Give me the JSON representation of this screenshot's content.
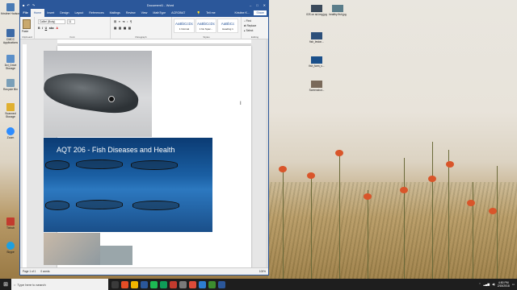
{
  "desktop": {
    "left_icons": [
      {
        "label": "Kristine Hodson",
        "color": "#4a7bb5"
      },
      {
        "label": "CMCC Applications",
        "color": "#3d6aa6"
      },
      {
        "label": "3rd_Drive Storage",
        "color": "#5b8fc9"
      },
      {
        "label": "Recycle Bin",
        "color": "#7a9fb8"
      },
      {
        "label": "Scanned Storage",
        "color": "#e0b030"
      },
      {
        "label": "Zoom",
        "color": "#2d8cff"
      },
      {
        "label": "Tixhub",
        "color": "#c23b2e"
      },
      {
        "label": "Skype",
        "color": "#1ea0e0"
      }
    ],
    "right_icons": [
      {
        "label": "IDS on sd-img.jpg"
      },
      {
        "label": "healthy fish.jpg"
      },
      {
        "label": "fish_lesion..."
      },
      {
        "label": "fish_farm_s..."
      },
      {
        "label": "fish_farm_s..."
      },
      {
        "label": "Screenshot..."
      }
    ]
  },
  "word": {
    "title": "Document1 - Word",
    "tabs": [
      "File",
      "Home",
      "Insert",
      "Design",
      "Layout",
      "References",
      "Mailings",
      "Review",
      "View",
      "MathType",
      "ACROBAT"
    ],
    "tell_me": "Tell me",
    "user": "Kristine K...",
    "share": "Share",
    "ribbon": {
      "paste_label": "Paste",
      "font_name": "Calibri (Body)",
      "font_size": "11",
      "styles": [
        {
          "preview": "AaBbCcDc",
          "name": "1 Normal"
        },
        {
          "preview": "AaBbCcDc",
          "name": "1 No Spac..."
        },
        {
          "preview": "AaBbCc",
          "name": "Heading 1"
        }
      ],
      "groups": [
        "Clipboard",
        "Font",
        "Paragraph",
        "Styles",
        "Editing"
      ],
      "editing": [
        "Find",
        "Replace",
        "Select"
      ]
    },
    "slide_title": "AQT 206 - Fish Diseases and Health",
    "status": {
      "page": "Page 1 of 1",
      "words": "0 words",
      "zoom": "100%"
    }
  },
  "taskbar": {
    "search_placeholder": "Type here to search",
    "time": "4:50 PM",
    "date": "2/15/2018",
    "app_colors": [
      "#3b3b3b",
      "#e44d26",
      "#f2b600",
      "#2b579a",
      "#1db954",
      "#0f9d58",
      "#c23b2e",
      "#7a7a7a",
      "#dd4b39",
      "#2d7dd2",
      "#3c8d2f",
      "#2b579a"
    ]
  }
}
